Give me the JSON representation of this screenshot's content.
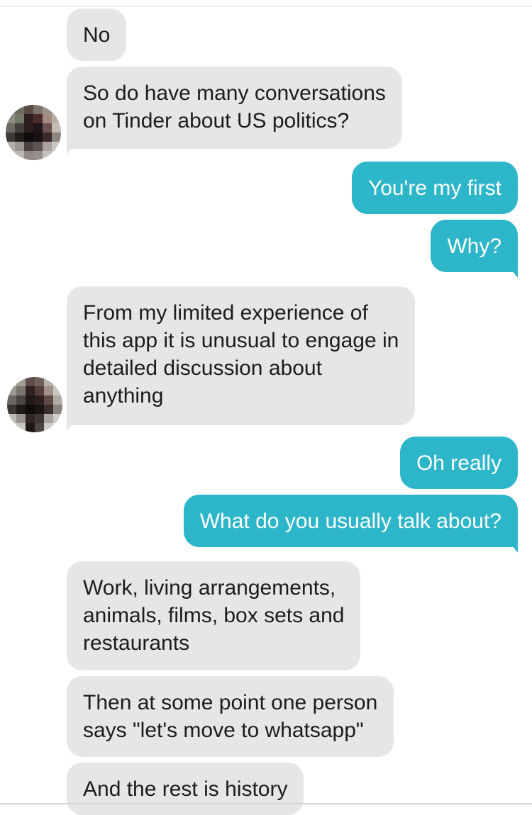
{
  "messages": [
    {
      "sender": "match",
      "text": "No"
    },
    {
      "sender": "match",
      "lines": [
        "So do have many conversations",
        "on Tinder about US politics?"
      ]
    },
    {
      "sender": "me",
      "text": "You're my first"
    },
    {
      "sender": "me",
      "text": "Why?"
    },
    {
      "sender": "match",
      "lines": [
        "From my limited experience of",
        "this app it is unusual to engage in",
        "detailed discussion about",
        "anything"
      ]
    },
    {
      "sender": "me",
      "text": "Oh really"
    },
    {
      "sender": "me",
      "text": "What do you usually talk about?"
    },
    {
      "sender": "match",
      "lines": [
        "Work, living arrangements,",
        "animals, films, box sets and",
        "restaurants"
      ]
    },
    {
      "sender": "match",
      "lines": [
        "Then at some point one person",
        "says \"let's move to whatsapp\""
      ]
    },
    {
      "sender": "match",
      "text": "And the rest is history"
    }
  ],
  "colors": {
    "incoming_bubble": "#e6e6e6",
    "outgoing_bubble": "#2db5c9",
    "incoming_text": "#1c1c1c",
    "outgoing_text": "#ffffff"
  },
  "avatar": {
    "icon": "pixelated-avatar-icon"
  }
}
